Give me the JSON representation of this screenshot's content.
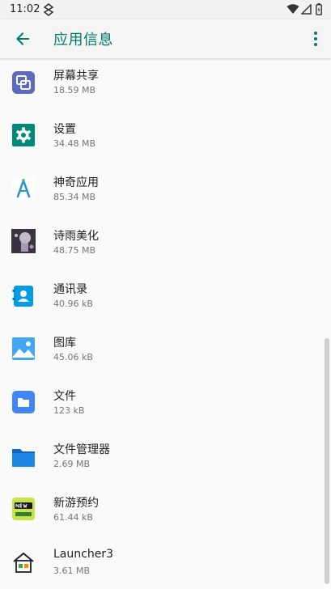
{
  "status_bar": {
    "time": "11:02"
  },
  "app_bar": {
    "title": "应用信息"
  },
  "apps": [
    {
      "name": "屏幕共享",
      "size": "18.59 MB",
      "icon": "screen-share-icon"
    },
    {
      "name": "设置",
      "size": "34.48 MB",
      "icon": "settings-gear-icon"
    },
    {
      "name": "神奇应用",
      "size": "85.34 MB",
      "icon": "magic-app-icon"
    },
    {
      "name": "诗雨美化",
      "size": "48.75 MB",
      "icon": "photo-thumbnail-icon"
    },
    {
      "name": "通讯录",
      "size": "40.96 kB",
      "icon": "contacts-icon"
    },
    {
      "name": "图库",
      "size": "45.06 kB",
      "icon": "gallery-icon"
    },
    {
      "name": "文件",
      "size": "123 kB",
      "icon": "files-icon"
    },
    {
      "name": "文件管理器",
      "size": "2.69 MB",
      "icon": "folder-icon"
    },
    {
      "name": "新游预约",
      "size": "61.44 kB",
      "icon": "new-game-icon"
    },
    {
      "name": "Launcher3",
      "size": "3.61 MB",
      "icon": "launcher-home-icon"
    }
  ],
  "colors": {
    "accent": "#00796b",
    "settings": "#00897b",
    "screen_share": "#5c6bc0",
    "contacts": "#039be5",
    "gallery": "#42a5f5",
    "files": "#4285f4"
  }
}
